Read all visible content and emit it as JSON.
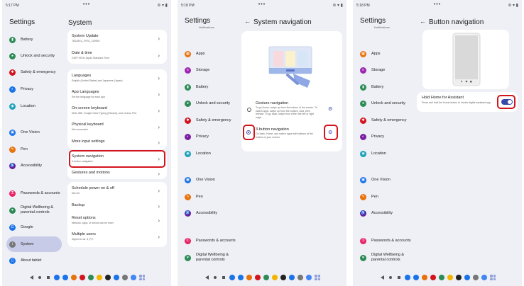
{
  "status": {
    "time1": "5:17 PM",
    "time2": "5:18 PM",
    "time3": "5:18 PM"
  },
  "sidebar": {
    "title": "Settings",
    "items": [
      {
        "label": "Battery",
        "color": "#2e8b57",
        "icon": "battery-icon"
      },
      {
        "label": "Unlock and security",
        "color": "#2e8b57",
        "icon": "lock-icon"
      },
      {
        "label": "Safety & emergency",
        "color": "#d3141d",
        "icon": "star-of-life-icon"
      },
      {
        "label": "Privacy",
        "color": "#1a73e8",
        "icon": "privacy-icon"
      },
      {
        "label": "Location",
        "color": "#1aa0b8",
        "icon": "location-icon"
      },
      {
        "label": "One Vision",
        "color": "#1a73e8",
        "icon": "one-vision-icon"
      },
      {
        "label": "Pen",
        "color": "#e8710a",
        "icon": "pen-icon"
      },
      {
        "label": "Accessibility",
        "color": "#6a1b9a",
        "icon": "accessibility-icon"
      },
      {
        "label": "Passwords & accounts",
        "color": "#e91e63",
        "icon": "key-icon"
      },
      {
        "label": "Digital Wellbeing & parental controls",
        "color": "#2e8b57",
        "icon": "wellbeing-icon"
      },
      {
        "label": "Google",
        "color": "#1a73e8",
        "icon": "google-icon"
      },
      {
        "label": "System",
        "color": "#777777",
        "icon": "info-icon"
      },
      {
        "label": "About tablet",
        "color": "#1a73e8",
        "icon": "tablet-icon"
      }
    ],
    "items2": [
      {
        "label": "Notifications",
        "color": "#2e8b57"
      },
      {
        "label": "Apps",
        "color": "#e8710a"
      },
      {
        "label": "Storage",
        "color": "#9c27b0"
      },
      {
        "label": "Battery",
        "color": "#2e8b57"
      },
      {
        "label": "Unlock and security",
        "color": "#2e8b57"
      },
      {
        "label": "Safety & emergency",
        "color": "#d3141d"
      },
      {
        "label": "Privacy",
        "color": "#7b1fa2"
      },
      {
        "label": "Location",
        "color": "#1aa0b8"
      },
      {
        "label": "One Vision",
        "color": "#1a73e8"
      },
      {
        "label": "Pen",
        "color": "#e8710a"
      },
      {
        "label": "Accessibility",
        "color": "#6a1b9a"
      },
      {
        "label": "Passwords & accounts",
        "color": "#e91e63"
      },
      {
        "label": "Digital Wellbeing & parental controls",
        "color": "#2e8b57"
      }
    ]
  },
  "system": {
    "title": "System",
    "rows": [
      {
        "title": "System Update",
        "sub": "TB128XU_RF01_230905"
      },
      {
        "title": "Date & time",
        "sub": "GMT+09:00 Japan Standard Time"
      },
      {
        "title": "Languages",
        "sub": "English (United States) and Japanese (Japan)"
      },
      {
        "title": "App Languages",
        "sub": "Set the language for each app"
      },
      {
        "title": "On-screen keyboard",
        "sub": "Moto IME, Google Voice Typing (Gboard), and Lenovo Pen"
      },
      {
        "title": "Physical keyboard",
        "sub": "Not connected"
      },
      {
        "title": "More input settings",
        "sub": ""
      },
      {
        "title": "System navigation",
        "sub": "3-button navigation"
      },
      {
        "title": "Gestures and motions",
        "sub": ""
      },
      {
        "title": "Schedule power on & off",
        "sub": "Not set"
      },
      {
        "title": "Backup",
        "sub": ""
      },
      {
        "title": "Reset options",
        "sub": "Network, apps, or device can be reset"
      },
      {
        "title": "Multiple users",
        "sub": "Signed in as スマホ"
      }
    ]
  },
  "sysnav": {
    "title": "System navigation",
    "gesture_title": "Gesture navigation",
    "gesture_sub": "To go Home, swipe up from the bottom of the screen. To switch apps, swipe up from the bottom, hold, then release. To go back, swipe from either the left or right edge.",
    "button_title": "3-button navigation",
    "button_sub": "Go back, Home, and switch apps with buttons at the bottom of your screen."
  },
  "buttonnav": {
    "title": "Button navigation",
    "hold_title": "Hold Home for Assistant",
    "hold_sub": "Press and hold the Home button to invoke digital assistant app"
  },
  "colors": {
    "accent": "#3a49a8",
    "highlight": "#d3141d"
  }
}
